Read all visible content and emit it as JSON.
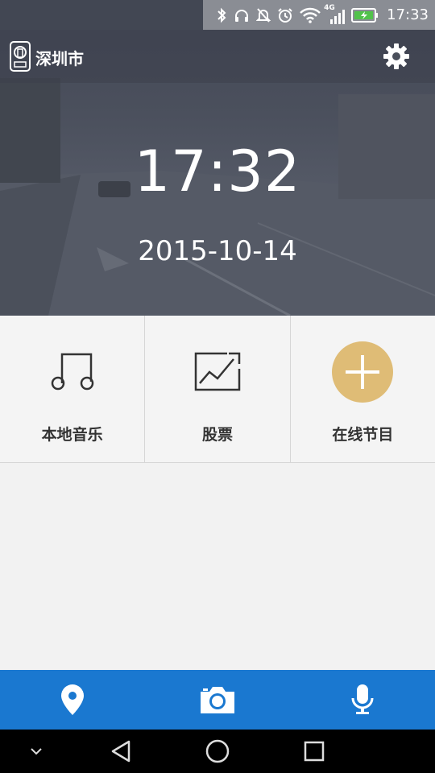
{
  "status_bar": {
    "time": "17:33",
    "network": "4G",
    "icons": [
      "bluetooth-icon",
      "headphones-icon",
      "mute-icon",
      "alarm-icon",
      "wifi-icon",
      "signal-icon",
      "battery-charging-icon"
    ]
  },
  "header": {
    "city": "深圳市",
    "logo_icon": "city-logo-icon",
    "settings_icon": "gear-icon"
  },
  "hero": {
    "time": "17:32",
    "date": "2015-10-14"
  },
  "tiles": [
    {
      "label": "本地音乐",
      "icon": "music-note-icon"
    },
    {
      "label": "股票",
      "icon": "stock-chart-icon"
    },
    {
      "label": "在线节目",
      "icon": "add-circle-icon"
    }
  ],
  "bottom_bar": {
    "items": [
      "location-pin-icon",
      "camera-icon",
      "microphone-icon"
    ],
    "color": "#1a78d0"
  },
  "nav_bar": {
    "items": [
      "collapse-icon",
      "back-icon",
      "home-icon",
      "recents-icon"
    ]
  },
  "colors": {
    "accent_circle": "#dfbc76",
    "header_bg": "#424753"
  }
}
